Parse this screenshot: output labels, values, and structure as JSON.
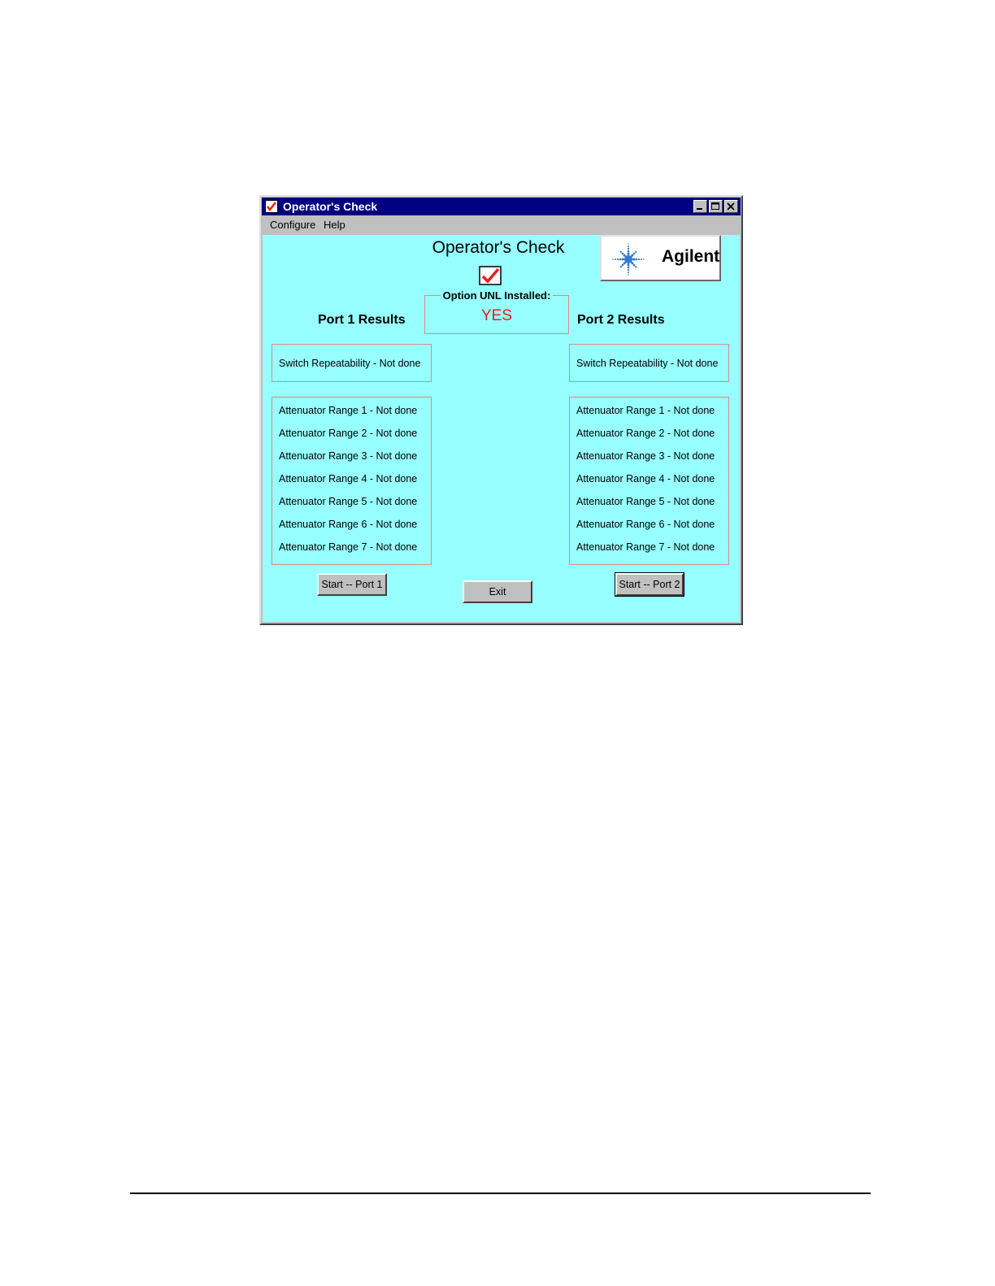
{
  "window": {
    "title": "Operator's Check",
    "controls": [
      "minimize-icon",
      "maximize-icon",
      "close-icon"
    ]
  },
  "menu": {
    "configure": "Configure",
    "help": "Help"
  },
  "main": {
    "title": "Operator's Check",
    "logo_text": "Agilent",
    "option_label": "Option UNL Installed:",
    "option_value": "YES"
  },
  "port1": {
    "title": "Port 1 Results",
    "switch": "Switch Repeatability - Not done",
    "attenuators": [
      "Attenuator Range 1 - Not done",
      "Attenuator Range 2 - Not done",
      "Attenuator Range 3 - Not done",
      "Attenuator Range 4 - Not done",
      "Attenuator Range 5 - Not done",
      "Attenuator Range 6 - Not done",
      "Attenuator Range 7 - Not done"
    ],
    "start_label": "Start -- Port 1"
  },
  "port2": {
    "title": "Port 2 Results",
    "switch": "Switch Repeatability - Not done",
    "attenuators": [
      "Attenuator Range 1 - Not done",
      "Attenuator Range 2 - Not done",
      "Attenuator Range 3 - Not done",
      "Attenuator Range 4 - Not done",
      "Attenuator Range 5 - Not done",
      "Attenuator Range 6 - Not done",
      "Attenuator Range 7 - Not done"
    ],
    "start_label": "Start -- Port 2"
  },
  "buttons": {
    "exit_label": "Exit"
  },
  "colors": {
    "titlebar": "#000080",
    "client_bg": "#97ffff",
    "option_value": "#e8201a",
    "group_border": "#d98a8a",
    "logo_accent": "#2f78c9"
  }
}
